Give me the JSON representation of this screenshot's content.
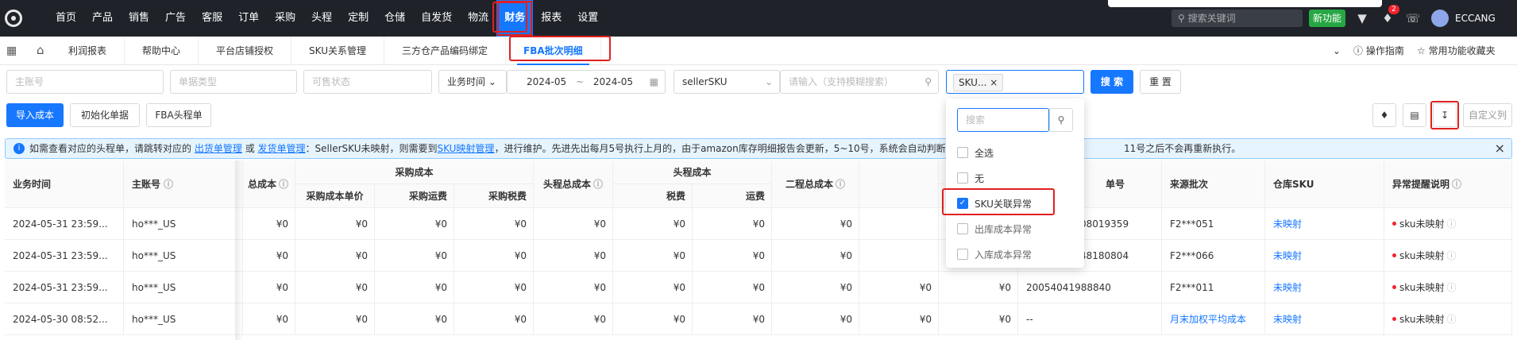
{
  "topnav": [
    "首页",
    "产品",
    "销售",
    "广告",
    "客服",
    "订单",
    "采购",
    "头程",
    "定制",
    "仓储",
    "自发货",
    "物流",
    "财务",
    "报表",
    "设置"
  ],
  "topbar": {
    "search_placeholder": "搜索关键词",
    "new_feature": "新功能",
    "badge": "2",
    "user": "ECCANG"
  },
  "tabs": [
    "利润报表",
    "帮助中心",
    "平台店铺授权",
    "SKU关系管理",
    "三方仓产品编码绑定",
    "FBA批次明细"
  ],
  "tabbar": {
    "guide": "操作指南",
    "favorites": "常用功能收藏夹"
  },
  "filters": {
    "account": "主账号",
    "doc_type": "单据类型",
    "sellable": "可售状态",
    "time_type": "业务时间",
    "date_start": "2024-05",
    "date_sep": "~",
    "date_end": "2024-05",
    "sku_type": "sellerSKU",
    "sku_input": "请输入（支持模糊搜索）",
    "tag": "SKU...",
    "search": "搜 索",
    "reset": "重 置"
  },
  "actions": {
    "import": "导入成本",
    "init": "初始化单据",
    "fba": "FBA头程单",
    "custom": "自定义列"
  },
  "notice": {
    "t1": "如需查看对应的头程单，请跳转对应的",
    "link1": "出货单管理",
    "t2": "或",
    "link2": "发货单管理",
    "t3": "：SellerSKU未映射，则需要到",
    "link3": "SKU映射管理",
    "t4": "，进行维护。先进先出每月5号执行上月的，由于amazon库存明细报告会更新，5~10号，系统会自动判断",
    "t5": "11号之后不会再重新执行。"
  },
  "table": {
    "headers": {
      "biz_time": "业务时间",
      "account": "主账号",
      "total_cost": "总成本",
      "purchase_cost": "采购成本",
      "unit_price": "采购成本单价",
      "purchase_freight": "采购运费",
      "purchase_tax": "采购税费",
      "headway_total": "头程总成本",
      "headway_cost": "头程成本",
      "tax": "税费",
      "freight": "运费",
      "second_total": "二程总成本",
      "partial": "运",
      "order_no": "单号",
      "source_batch": "来源批次",
      "warehouse_sku": "仓库SKU",
      "exception": "异常提醒说明"
    },
    "rows": [
      {
        "time": "2024-05-31 23:59...",
        "account": "ho***_US",
        "total": "¥0",
        "unit": "¥0",
        "pf": "¥0",
        "pt": "¥0",
        "ht": "¥0",
        "tax": "¥0",
        "fr": "¥0",
        "st": "¥0",
        "c1": "",
        "c2": "",
        "order": "08019359",
        "batch": "F2***051",
        "wsku": "未映射",
        "exc": "sku未映射"
      },
      {
        "time": "2024-05-31 23:59...",
        "account": "ho***_US",
        "total": "¥0",
        "unit": "¥0",
        "pf": "¥0",
        "pt": "¥0",
        "ht": "¥0",
        "tax": "¥0",
        "fr": "¥0",
        "st": "¥0",
        "c1": "",
        "c2": "",
        "order": "48180804",
        "batch": "F2***066",
        "wsku": "未映射",
        "exc": "sku未映射"
      },
      {
        "time": "2024-05-31 23:59...",
        "account": "ho***_US",
        "total": "¥0",
        "unit": "¥0",
        "pf": "¥0",
        "pt": "¥0",
        "ht": "¥0",
        "tax": "¥0",
        "fr": "¥0",
        "st": "¥0",
        "c1": "¥0",
        "c2": "¥0",
        "order": "20054041988840",
        "batch": "F2***011",
        "wsku": "未映射",
        "exc": "sku未映射"
      },
      {
        "time": "2024-05-30 08:52...",
        "account": "ho***_US",
        "total": "¥0",
        "unit": "¥0",
        "pf": "¥0",
        "pt": "¥0",
        "ht": "¥0",
        "tax": "¥0",
        "fr": "¥0",
        "st": "¥0",
        "c1": "¥0",
        "c2": "¥0",
        "order": "--",
        "batch": "月末加权平均成本",
        "wsku": "未映射",
        "exc": "sku未映射"
      }
    ]
  },
  "dropdown": {
    "search_placeholder": "搜索",
    "options": [
      {
        "label": "全选",
        "checked": false
      },
      {
        "label": "无",
        "checked": false
      },
      {
        "label": "SKU关联异常",
        "checked": true
      },
      {
        "label": "出库成本异常",
        "checked": false
      },
      {
        "label": "入库成本异常",
        "checked": false
      }
    ]
  }
}
